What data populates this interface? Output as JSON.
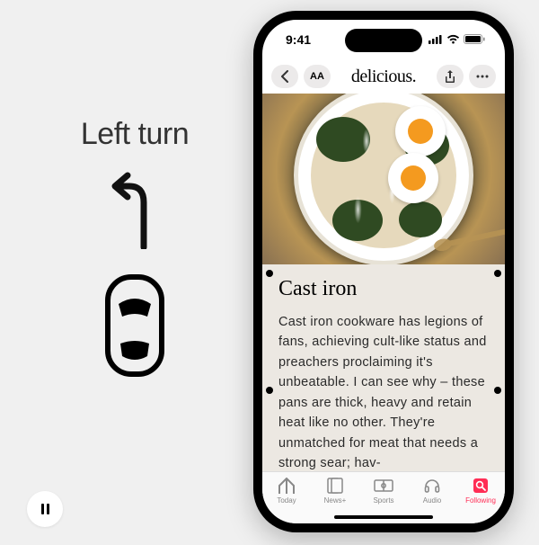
{
  "left_panel": {
    "label": "Left turn"
  },
  "status": {
    "time": "9:41"
  },
  "nav": {
    "text_size": "AA",
    "title": "delicious."
  },
  "article": {
    "title": "Cast iron",
    "body": "Cast iron cookware has legions of fans, achieving cult-like status and preachers proclaiming it's unbeatable. I can see why – these pans are thick, heavy and retain heat like no other. They're unmatched for meat that needs a strong sear; hav-"
  },
  "tabs": [
    {
      "label": "Today"
    },
    {
      "label": "News+"
    },
    {
      "label": "Sports"
    },
    {
      "label": "Audio"
    },
    {
      "label": "Following"
    }
  ],
  "active_tab_index": 4
}
